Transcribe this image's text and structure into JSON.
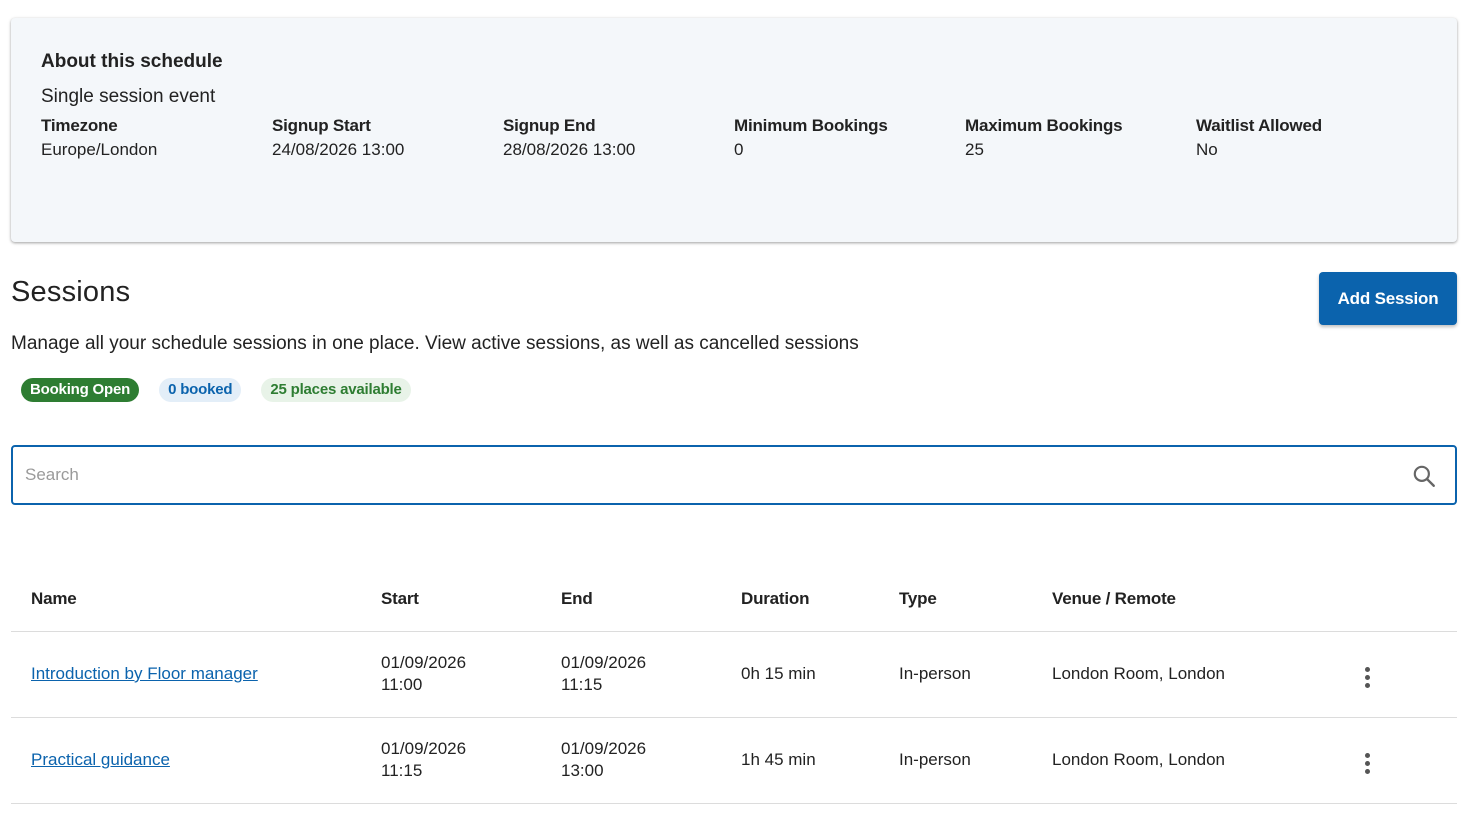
{
  "about": {
    "title": "About this schedule",
    "subtitle": "Single session event",
    "fields": [
      {
        "label": "Timezone",
        "value": "Europe/London"
      },
      {
        "label": "Signup Start",
        "value": "24/08/2026 13:00"
      },
      {
        "label": "Signup End",
        "value": "28/08/2026 13:00"
      },
      {
        "label": "Minimum Bookings",
        "value": "0"
      },
      {
        "label": "Maximum Bookings",
        "value": "25"
      },
      {
        "label": "Waitlist Allowed",
        "value": "No"
      }
    ]
  },
  "sessions": {
    "title": "Sessions",
    "add_label": "Add Session",
    "description": "Manage all your schedule sessions in one place. View active sessions, as well as cancelled sessions",
    "badges": {
      "status": "Booking Open",
      "booked": "0 booked",
      "available": "25 places available"
    },
    "search": {
      "placeholder": "Search",
      "value": "",
      "icon": "search-icon"
    },
    "table": {
      "headers": [
        "Name",
        "Start",
        "End",
        "Duration",
        "Type",
        "Venue / Remote"
      ],
      "rows": [
        {
          "name": "Introduction by Floor manager",
          "start_date": "01/09/2026",
          "start_time": "11:00",
          "end_date": "01/09/2026",
          "end_time": "11:15",
          "duration": "0h 15 min",
          "type": "In-person",
          "venue": "London Room, London"
        },
        {
          "name": "Practical guidance",
          "start_date": "01/09/2026",
          "start_time": "11:15",
          "end_date": "01/09/2026",
          "end_time": "13:00",
          "duration": "1h 45 min",
          "type": "In-person",
          "venue": "London Room, London"
        }
      ]
    }
  },
  "colors": {
    "primary": "#0b63ad",
    "success": "#2e7d32",
    "card_bg": "#f4f7fa"
  }
}
